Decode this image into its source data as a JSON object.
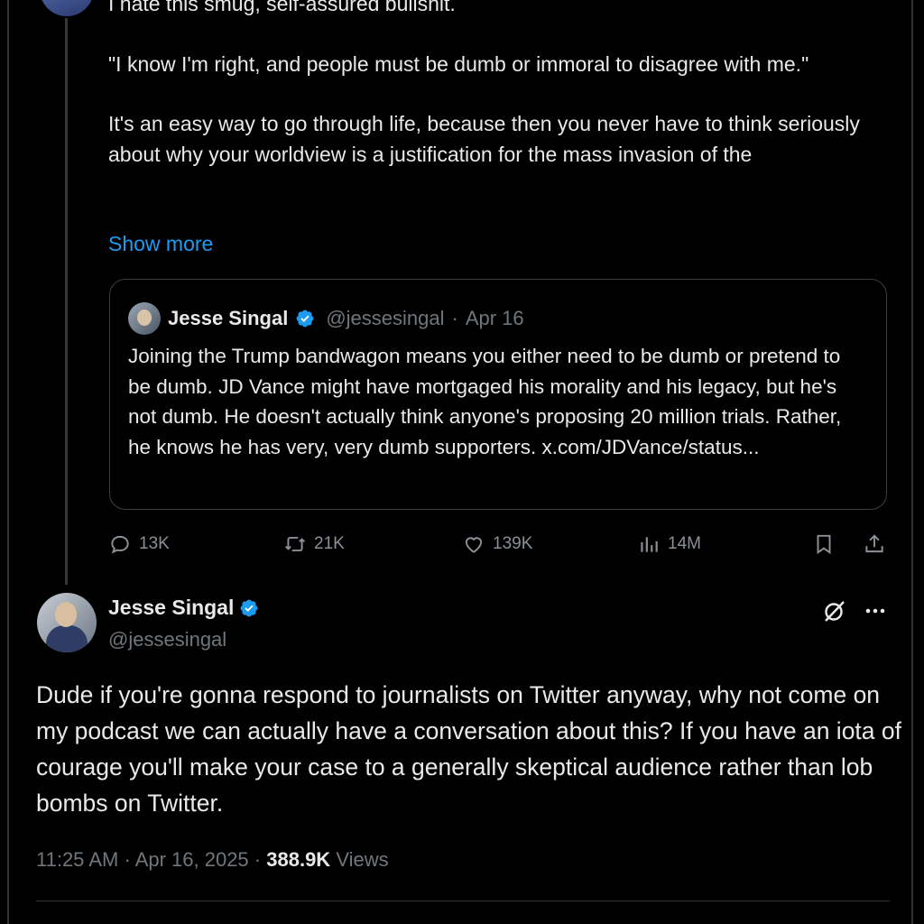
{
  "parent_tweet": {
    "paragraphs": [
      "I hate this smug, self-assured bullshit.",
      "\"I know I'm right, and people must be dumb or immoral to disagree with me.\"",
      "It's an easy way to go through life, because then you never have to think seriously about why your worldview is a justification for the mass invasion of the"
    ],
    "show_more": "Show more",
    "quote": {
      "name": "Jesse Singal",
      "handle": "@jessesingal",
      "separator": "·",
      "date": "Apr 16",
      "text": "Joining the Trump bandwagon means you either need to be dumb or pretend to be dumb. JD Vance might have mortgaged his morality and his legacy, but he's not dumb. He doesn't actually think anyone's proposing 20 million trials. Rather, he knows he has very, very dumb supporters. x.com/JDVance/status..."
    },
    "actions": {
      "replies": "13K",
      "reposts": "21K",
      "likes": "139K",
      "views": "14M"
    }
  },
  "main_tweet": {
    "name": "Jesse Singal",
    "handle": "@jessesingal",
    "text": "Dude if you're gonna respond to journalists on Twitter anyway, why not come on my podcast we can actually have a conversation about this? If you have an iota of courage you'll make your case to a generally skeptical audience rather than lob bombs on Twitter.",
    "time": "11:25 AM",
    "separator": "·",
    "date": "Apr 16, 2025",
    "views_count": "388.9K",
    "views_label": "Views"
  },
  "colors": {
    "background": "#000000",
    "text": "#e7e9ea",
    "muted": "#71767b",
    "link": "#1d9bf0",
    "verified": "#1d9bf0",
    "border": "#2f3336"
  },
  "icons": [
    "reply-icon",
    "repost-icon",
    "like-icon",
    "views-icon",
    "bookmark-icon",
    "share-icon",
    "grok-icon",
    "more-icon",
    "verified-badge-icon"
  ]
}
